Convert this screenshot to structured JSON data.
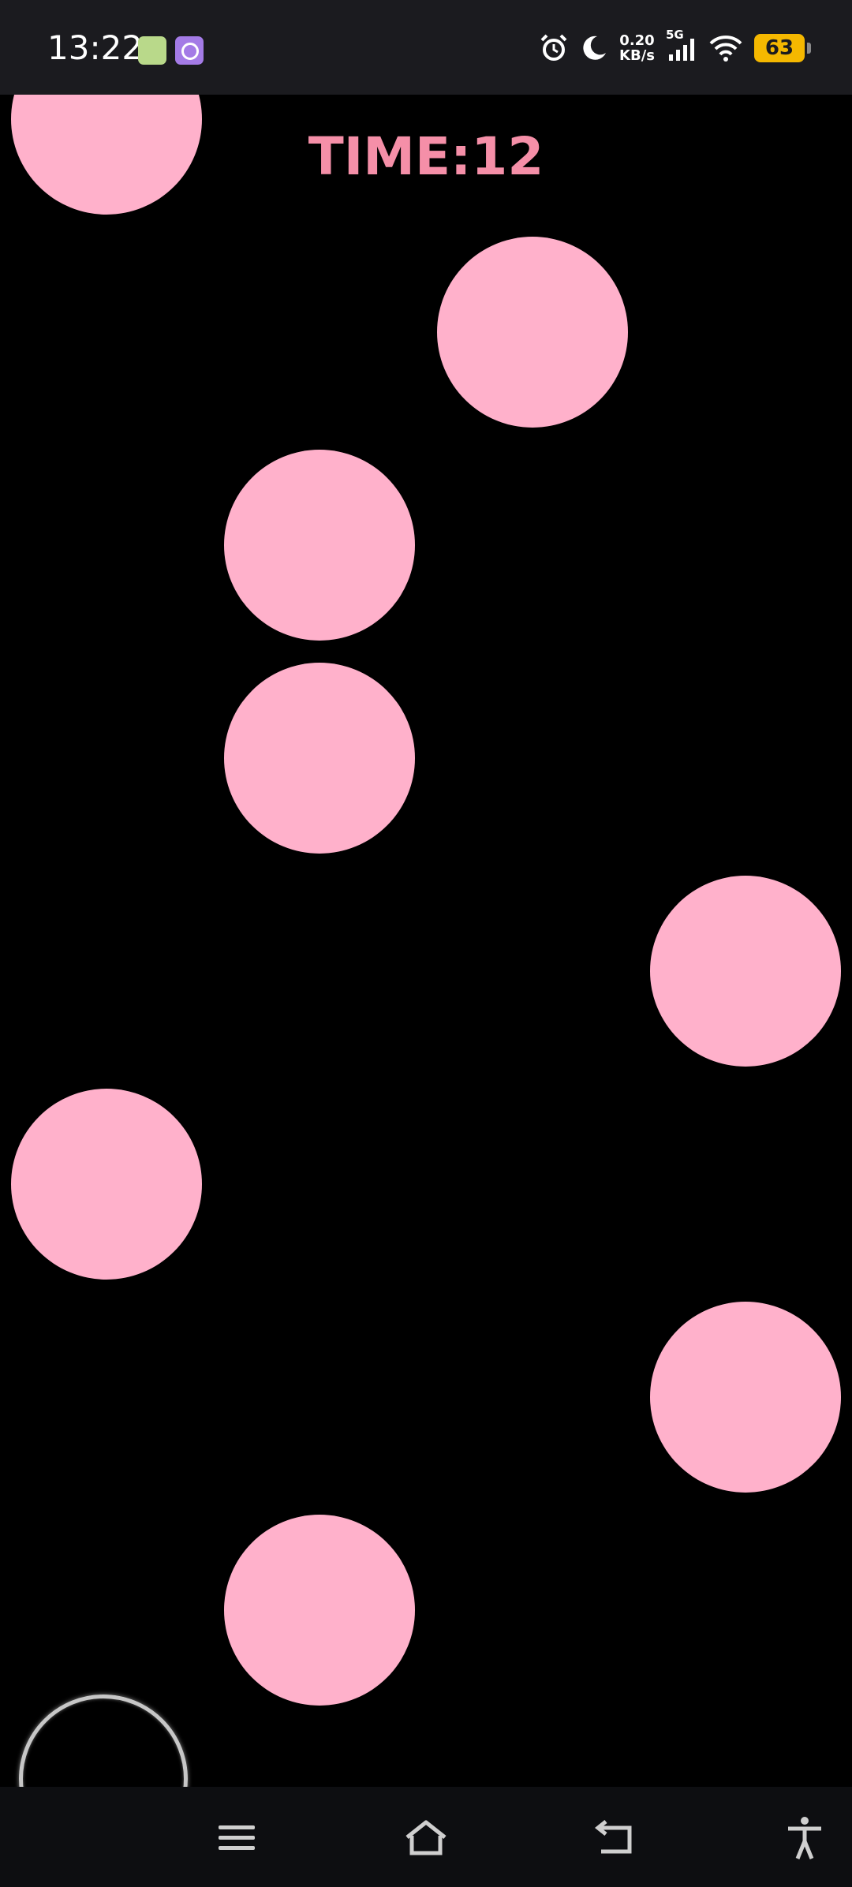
{
  "status_bar": {
    "time": "13:22",
    "net_speed_value": "0.20",
    "net_speed_unit": "KB/s",
    "network_type": "5G",
    "battery_level": "63",
    "icons": [
      "app-icon-green",
      "app-icon-purple",
      "alarm-icon",
      "moon-icon",
      "signal-icon",
      "wifi-icon",
      "battery-icon"
    ]
  },
  "game": {
    "timer_text": "TIME:12",
    "tile_color": "#ffb1cb",
    "timer_color": "#f58fa8",
    "background_color": "#000000",
    "columns": 4,
    "tiles": [
      {
        "column": 1,
        "row": 0
      },
      {
        "column": 3,
        "row": 1
      },
      {
        "column": 2,
        "row": 2
      },
      {
        "column": 2,
        "row": 3
      },
      {
        "column": 4,
        "row": 4
      },
      {
        "column": 1,
        "row": 5
      },
      {
        "column": 4,
        "row": 6
      },
      {
        "column": 2,
        "row": 7
      }
    ]
  },
  "nav_bar": {
    "buttons": [
      "menu-icon",
      "home-icon",
      "back-icon",
      "accessibility-icon"
    ]
  }
}
